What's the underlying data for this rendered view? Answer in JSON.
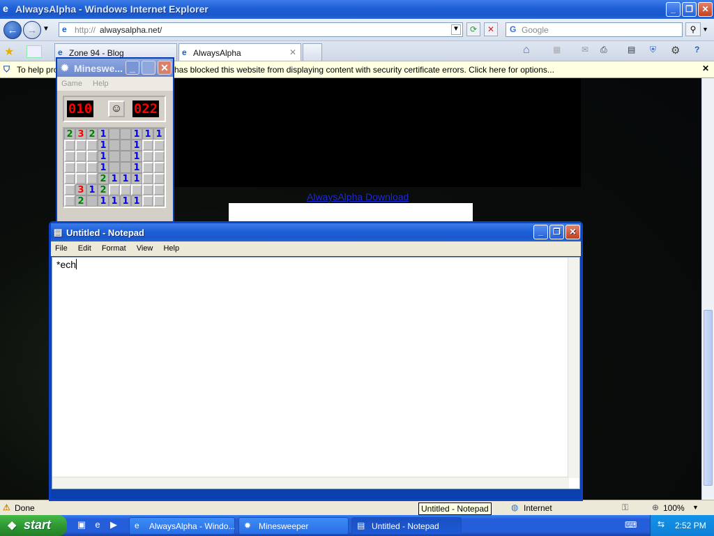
{
  "ie": {
    "title": "AlwaysAlpha - Windows Internet Explorer",
    "address_prefix": "http://",
    "address_host": "alwaysalpha.net/",
    "search_placeholder": "Google",
    "tabs": [
      {
        "label": "Zone 94 - Blog"
      },
      {
        "label": "AlwaysAlpha"
      }
    ],
    "infobar_lead": "To help prot",
    "infobar_text": "has blocked this website from displaying content with security certificate errors. Click here for options...",
    "page_link": "AlwaysAlpha Download",
    "status_text": "Done",
    "zone": "Internet",
    "zoom": "100%",
    "tooltip": "Untitled - Notepad"
  },
  "minesweeper": {
    "title": "Mineswe...",
    "menu": [
      "Game",
      "Help"
    ],
    "mine_counter": "010",
    "timer": "022",
    "smiley": "☺",
    "rows": [
      [
        "2",
        "3",
        "2",
        "1",
        "",
        "",
        "1",
        "1",
        "1"
      ],
      [
        "#",
        "#",
        "#",
        "1",
        "",
        "",
        "1",
        "#",
        "#"
      ],
      [
        "#",
        "#",
        "#",
        "1",
        "",
        "",
        "1",
        "#",
        "#"
      ],
      [
        "#",
        "#",
        "#",
        "1",
        "",
        "",
        "1",
        "#",
        "#"
      ],
      [
        "#",
        "#",
        "#",
        "2",
        "1",
        "1",
        "1",
        "#",
        "#"
      ],
      [
        "#",
        "3",
        "1",
        "2",
        "#",
        "#",
        "#",
        "#",
        "#"
      ],
      [
        "#",
        "2",
        "",
        "1",
        "1",
        "1",
        "1",
        "#",
        "#"
      ]
    ],
    "number_colors": {
      "1": "#0000ff",
      "2": "#008000",
      "3": "#ff0000"
    }
  },
  "notepad": {
    "title": "Untitled - Notepad",
    "menu": [
      "File",
      "Edit",
      "Format",
      "View",
      "Help"
    ],
    "content": "*ech"
  },
  "taskbar": {
    "start_label": "start",
    "buttons": [
      {
        "label": "AlwaysAlpha - Windo..."
      },
      {
        "label": "Minesweeper"
      },
      {
        "label": "Untitled - Notepad"
      }
    ],
    "clock": "2:52 PM"
  }
}
